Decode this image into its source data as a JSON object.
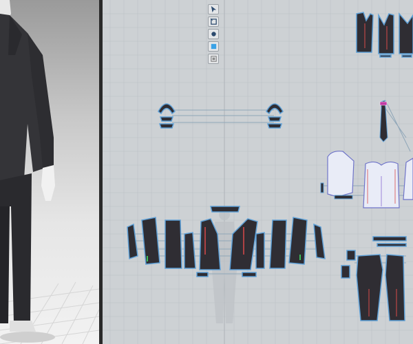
{
  "app": {
    "panels": [
      "3d-avatar-view",
      "2d-pattern-window"
    ]
  },
  "toolbar": {
    "tools": [
      {
        "name": "select-move-tool",
        "icon": "pointer-icon"
      },
      {
        "name": "transform-pattern-tool",
        "icon": "transform-icon"
      },
      {
        "name": "edit-pattern-tool",
        "icon": "edit-point-icon"
      },
      {
        "name": "fabric-tool",
        "icon": "fabric-icon"
      },
      {
        "name": "texture-tool",
        "icon": "texture-icon"
      }
    ]
  },
  "colors": {
    "canvas_bg": "#cdd1d4",
    "grid_line": "#bcc1c5",
    "pattern_fill": "#2f2d33",
    "pattern_outline": "#5d9fd6",
    "selected_fill": "#e9ecf7",
    "selected_outline": "#6f74c9",
    "seam_line": "#8fa6b8",
    "internal_red": "#d94a4a",
    "internal_green": "#3bbf5a"
  },
  "garment": {
    "items": [
      "suit-jacket",
      "vest",
      "trousers",
      "necktie",
      "shirt"
    ],
    "selected": "shirt"
  }
}
